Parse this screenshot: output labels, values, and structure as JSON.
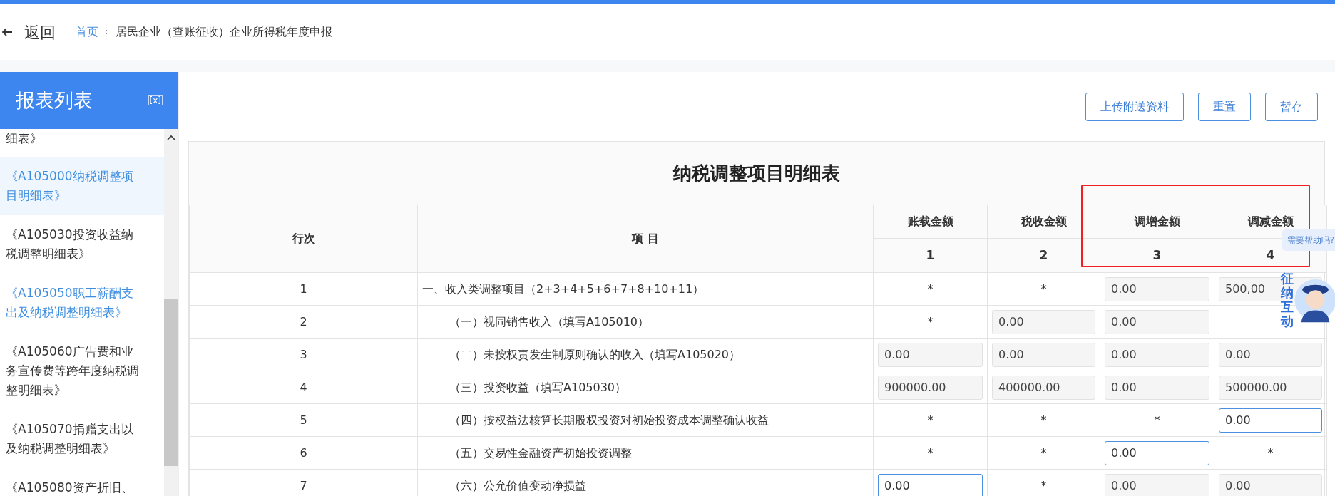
{
  "header": {
    "back": "返回",
    "breadcrumb": [
      {
        "label": "首页",
        "link": true
      },
      {
        "label": "居民企业（查账征收）企业所得税年度申报",
        "link": false
      }
    ]
  },
  "sidebar": {
    "title": "报表列表",
    "collapse": "[ⅹ]",
    "items": [
      {
        "label": "细表》",
        "selected": false,
        "visited": false
      },
      {
        "label": "《A105000纳税调整项目明细表》",
        "selected": true,
        "visited": true
      },
      {
        "label": "《A105030投资收益纳税调整明细表》",
        "selected": false,
        "visited": false
      },
      {
        "label": "《A105050职工薪酬支出及纳税调整明细表》",
        "selected": false,
        "visited": true
      },
      {
        "label": "《A105060广告费和业务宣传费等跨年度纳税调整明细表》",
        "selected": false,
        "visited": false
      },
      {
        "label": "《A105070捐赠支出以及纳税调整明细表》",
        "selected": false,
        "visited": false
      },
      {
        "label": "《A105080资产折旧、",
        "selected": false,
        "visited": false
      }
    ]
  },
  "toolbar": [
    "上传附送资料",
    "重置",
    "暂存"
  ],
  "table": {
    "title": "纳税调整项目明细表",
    "columns": [
      "行次",
      "项 目",
      "账载金额",
      "税收金额",
      "调增金额",
      "调减金额"
    ],
    "column_numbers": [
      "1",
      "2",
      "3",
      "4"
    ],
    "rows": [
      {
        "cells": [
          {
            "kind": "line",
            "text": "1"
          },
          {
            "kind": "item",
            "text": "一、收入类调整项目（2+3+4+5+6+7+8+10+11）"
          },
          {
            "kind": "star",
            "text": "*"
          },
          {
            "kind": "star",
            "text": "*"
          },
          {
            "kind": "readonly",
            "text": "0.00"
          },
          {
            "kind": "readonly",
            "text": "500,00"
          }
        ],
        "children": [
          {
            "cells": [
              {
                "kind": "line",
                "text": "2"
              },
              {
                "kind": "item",
                "text": "（一）视同销售收入（填写A105010）"
              },
              {
                "kind": "star",
                "text": "*"
              },
              {
                "kind": "readonly",
                "text": "0.00"
              },
              {
                "kind": "readonly",
                "text": "0.00"
              },
              {
                "kind": "hidden"
              }
            ]
          },
          {
            "cells": [
              {
                "kind": "line",
                "text": "3"
              },
              {
                "kind": "item",
                "text": "（二）未按权责发生制原则确认的收入（填写A105020）"
              },
              {
                "kind": "readonly",
                "text": "0.00"
              },
              {
                "kind": "readonly",
                "text": "0.00"
              },
              {
                "kind": "readonly",
                "text": "0.00"
              },
              {
                "kind": "readonly",
                "text": "0.00"
              }
            ]
          },
          {
            "cells": [
              {
                "kind": "line",
                "text": "4"
              },
              {
                "kind": "item",
                "text": "（三）投资收益（填写A105030）"
              },
              {
                "kind": "readonly",
                "text": "900000.00"
              },
              {
                "kind": "readonly",
                "text": "400000.00"
              },
              {
                "kind": "readonly",
                "text": "0.00"
              },
              {
                "kind": "readonly",
                "text": "500000.00"
              }
            ]
          },
          {
            "cells": [
              {
                "kind": "line",
                "text": "5"
              },
              {
                "kind": "item",
                "text": "（四）按权益法核算长期股权投资对初始投资成本调整确认收益"
              },
              {
                "kind": "star",
                "text": "*"
              },
              {
                "kind": "star",
                "text": "*"
              },
              {
                "kind": "star",
                "text": "*"
              },
              {
                "kind": "input",
                "text": "0.00"
              }
            ]
          },
          {
            "cells": [
              {
                "kind": "line",
                "text": "6"
              },
              {
                "kind": "item",
                "text": "（五）交易性金融资产初始投资调整"
              },
              {
                "kind": "star",
                "text": "*"
              },
              {
                "kind": "star",
                "text": "*"
              },
              {
                "kind": "input",
                "text": "0.00"
              },
              {
                "kind": "star",
                "text": "*"
              }
            ]
          },
          {
            "cells": [
              {
                "kind": "line",
                "text": "7"
              },
              {
                "kind": "item",
                "text": "（六）公允价值变动净损益"
              },
              {
                "kind": "input",
                "text": "0.00"
              },
              {
                "kind": "star",
                "text": "*"
              },
              {
                "kind": "readonly",
                "text": "0.00"
              },
              {
                "kind": "readonly",
                "text": "0.00"
              }
            ]
          }
        ]
      }
    ]
  },
  "assistant": {
    "label": "征纳互动",
    "tooltip": "需要帮助吗?"
  }
}
